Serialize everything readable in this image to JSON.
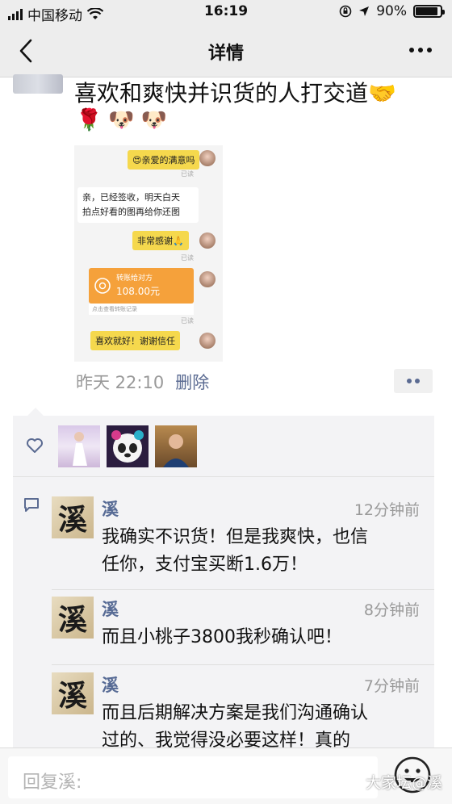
{
  "status_bar": {
    "carrier": "中国移动",
    "time": "16:19",
    "battery": "90%",
    "battery_level": 0.9
  },
  "nav": {
    "title": "详情",
    "back_icon": "chevron-left-icon",
    "more_icon": "more-dots-icon"
  },
  "post": {
    "text": "喜欢和爽快并识货的人打交道🤝",
    "emojis": [
      "🌹",
      "🐶",
      "🐶"
    ],
    "time": "昨天 22:10",
    "delete_label": "删除",
    "embedded_chat": {
      "msg1": "😍亲爱的满意吗",
      "read1": "已读",
      "msg2_line1": "亲，已经签收，明天白天",
      "msg2_line2": "拍点好看的图再给你还图",
      "msg3": "非常感谢🙏",
      "read3": "已读",
      "transfer_label": "转账给对方",
      "transfer_amount": "108.00元",
      "transfer_link": "点击查看转账记录",
      "read_transfer": "已读",
      "msg4": "喜欢就好！谢谢信任"
    }
  },
  "likes": {
    "icon": "heart-outline-icon",
    "avatars": [
      "avatar-woman-white-dress",
      "avatar-panda",
      "avatar-man-portrait"
    ]
  },
  "comments": [
    {
      "name": "溪",
      "avatar_char": "溪",
      "time": "12分钟前",
      "line1": "我确实不识货！但是我爽快，也信",
      "line2": "任你，支付宝买断1.6万！"
    },
    {
      "name": "溪",
      "avatar_char": "溪",
      "time": "8分钟前",
      "line1": "而且小桃子3800我秒确认吧！"
    },
    {
      "name": "溪",
      "avatar_char": "溪",
      "time": "7分钟前",
      "line1": "而且后期解决方案是我们沟通确认",
      "line2": "过的、我觉得没必要这样！真的"
    }
  ],
  "reply": {
    "placeholder": "回复溪:",
    "emoji_icon": "smiley-face-icon"
  },
  "watermark": "大家坛@溪"
}
